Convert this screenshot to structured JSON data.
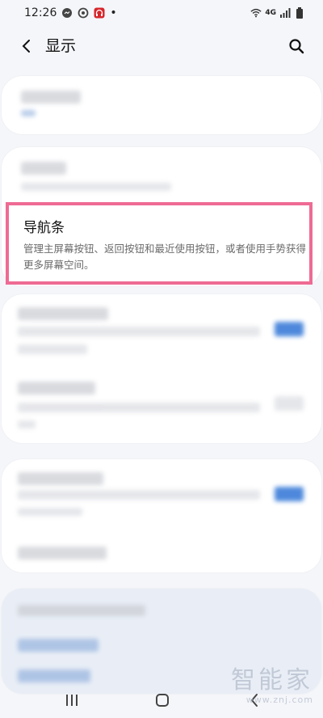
{
  "status_bar": {
    "time": "12:26",
    "network": "4G",
    "dot": "•",
    "icons": [
      "messenger-icon",
      "sync-icon",
      "headset-icon",
      "wifi-icon",
      "signal-icon",
      "battery-icon"
    ]
  },
  "header": {
    "title": "显示",
    "back_icon": "chevron-left-icon",
    "search_icon": "search-icon"
  },
  "navigation_bar_item": {
    "title": "导航条",
    "description": "管理主屏幕按钮、返回按钮和最近使用按钮，或者使用手势获得更多屏幕空间。",
    "highlight_color": "#ee6b94"
  },
  "bottom_nav": {
    "recents_icon": "recents-icon",
    "home_icon": "home-icon",
    "back_icon": "back-icon"
  },
  "watermark": {
    "main": "智能家",
    "sub": "www.znj.com"
  },
  "colors": {
    "background": "#f5f6fa",
    "card": "#ffffff",
    "accent_blue": "#2f74d6"
  }
}
